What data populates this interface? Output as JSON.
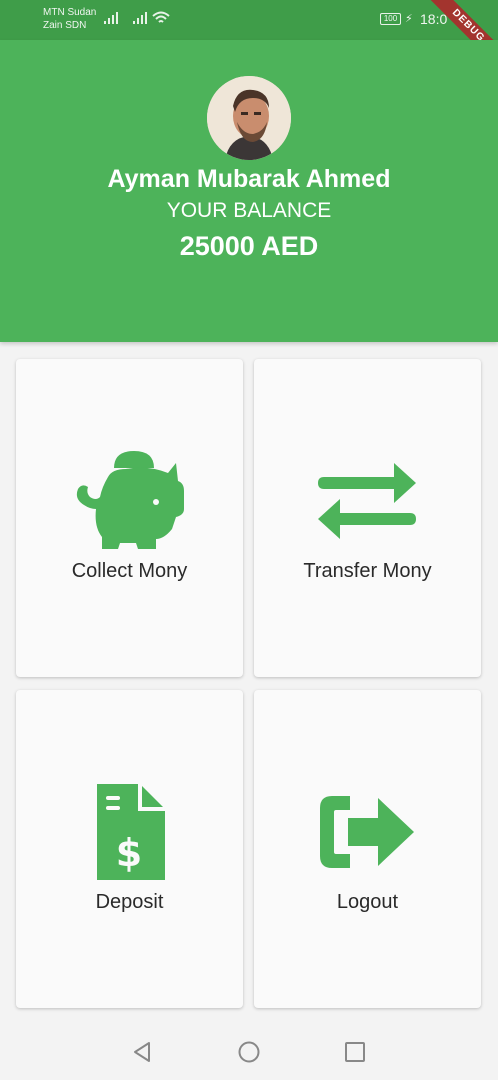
{
  "status_bar": {
    "carrier_1": "MTN Sudan",
    "carrier_2": "Zain SDN",
    "battery": "100",
    "time": "18:0"
  },
  "debug_banner": "DEBUG",
  "header": {
    "user_name": "Ayman Mubarak Ahmed",
    "balance_label": "YOUR BALANCE",
    "balance_amount": "25000 AED"
  },
  "menu": {
    "collect": {
      "label": "Collect Mony",
      "icon": "piggy-bank-icon"
    },
    "transfer": {
      "label": "Transfer Mony",
      "icon": "exchange-arrows-icon"
    },
    "deposit": {
      "label": "Deposit",
      "icon": "invoice-dollar-icon"
    },
    "logout": {
      "label": "Logout",
      "icon": "sign-out-icon"
    }
  },
  "colors": {
    "primary": "#4db35a",
    "status_bar": "#3f9d49",
    "background": "#f3f3f3",
    "card": "#fafafa"
  }
}
